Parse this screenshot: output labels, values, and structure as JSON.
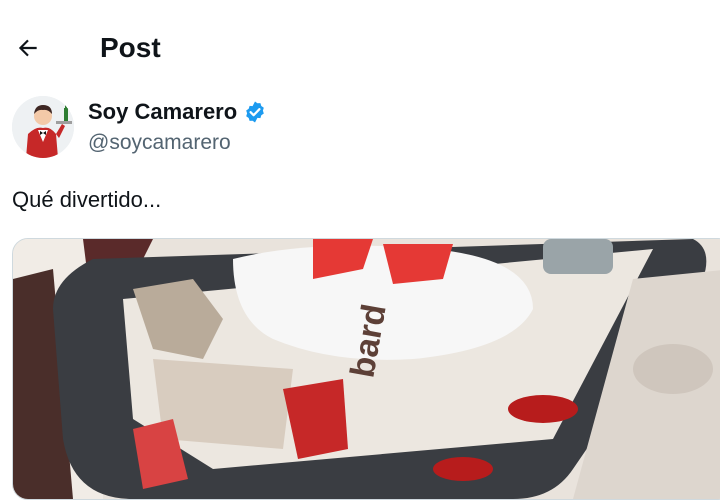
{
  "header": {
    "title": "Post"
  },
  "author": {
    "display_name": "Soy Camarero",
    "handle": "@soycamarero",
    "verified": true
  },
  "post": {
    "text": "Qué divertido..."
  },
  "colors": {
    "accent": "#1d9bf0",
    "secondary_text": "#536471",
    "border": "#cfd9de"
  },
  "icons": {
    "back": "arrow-left-icon",
    "verified": "verified-badge-icon"
  }
}
